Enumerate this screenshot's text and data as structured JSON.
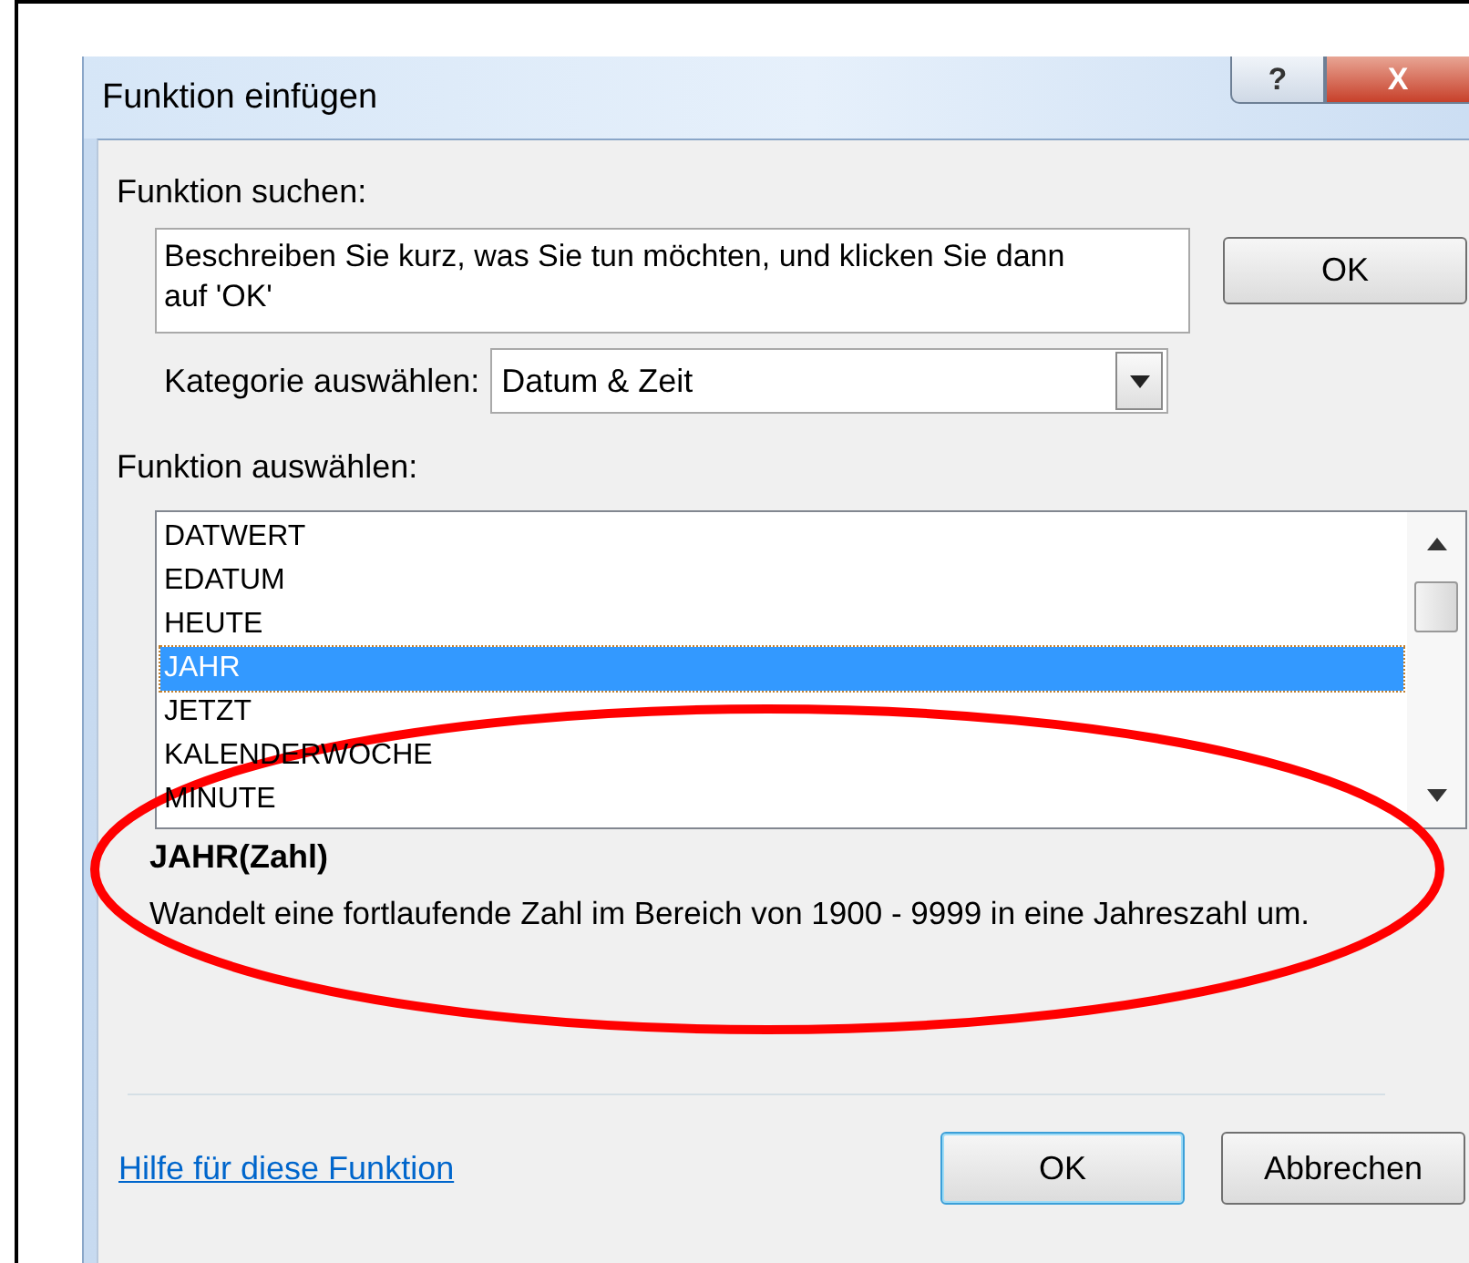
{
  "window": {
    "title": "Funktion einfügen",
    "help_button": "?",
    "close_button": "X"
  },
  "search": {
    "label": "Funktion suchen:",
    "value": "Beschreiben Sie kurz, was Sie tun möchten, und klicken Sie dann auf 'OK'",
    "button": "OK"
  },
  "category": {
    "label": "Kategorie auswählen:",
    "value": "Datum & Zeit"
  },
  "functions": {
    "label": "Funktion auswählen:",
    "items": [
      {
        "label": "DATWERT",
        "selected": false
      },
      {
        "label": "EDATUM",
        "selected": false
      },
      {
        "label": "HEUTE",
        "selected": false
      },
      {
        "label": "JAHR",
        "selected": true
      },
      {
        "label": "JETZT",
        "selected": false
      },
      {
        "label": "KALENDERWOCHE",
        "selected": false
      },
      {
        "label": "MINUTE",
        "selected": false
      }
    ]
  },
  "description": {
    "signature": "JAHR(Zahl)",
    "text": "Wandelt eine fortlaufende Zahl im Bereich von 1900 - 9999 in eine Jahreszahl um."
  },
  "help_link": "Hilfe für diese Funktion",
  "buttons": [
    "OK",
    "Abbrechen"
  ],
  "annotation": {
    "kind": "ellipse"
  }
}
